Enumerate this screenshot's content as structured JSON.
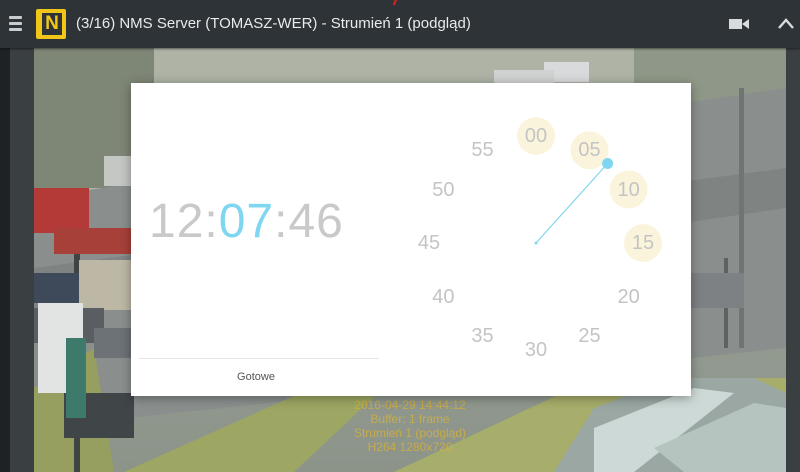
{
  "header": {
    "title": "(3/16) NMS Server (TOMASZ-WER) - Strumień 1 (podgląd)",
    "logo_letter": "N",
    "logo_color": "#f0c619",
    "icons": [
      "hamburger-icon",
      "video-camera-icon",
      "chevron-up-icon"
    ]
  },
  "overlay": {
    "lines": [
      "2016-04-29 14:44:12",
      "Buffer: 1 frame",
      "Strumień 1 (podgląd)",
      "H264 1280x720"
    ]
  },
  "picker": {
    "hour": "12",
    "separator1": ":",
    "minute": "07",
    "separator2": ":",
    "second": "46",
    "done_label": "Gotowe",
    "accent_color": "#7fd6f0",
    "clock_labels": [
      "00",
      "05",
      "10",
      "15",
      "20",
      "25",
      "30",
      "35",
      "40",
      "45",
      "50",
      "55"
    ],
    "selected_minute_value": 7
  }
}
